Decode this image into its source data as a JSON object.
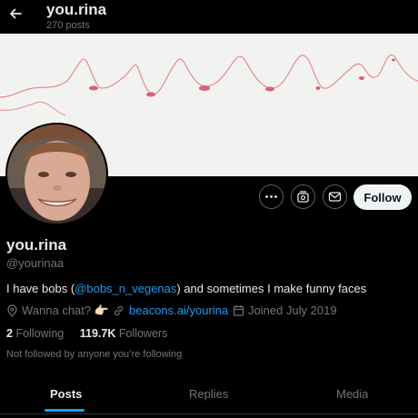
{
  "header": {
    "title": "you.rina",
    "post_count": "270 posts",
    "back_icon": "arrow-left-icon"
  },
  "profile": {
    "display_name": "you.rina",
    "handle": "@yourinaa",
    "bio": {
      "prefix": "I have bobs (",
      "mention": "@bobs_n_vegenas",
      "suffix": ") and sometimes I make funny faces"
    },
    "location": "Wanna chat? 👉🏻",
    "website": "beacons.ai/yourina",
    "joined": "Joined July 2019",
    "following_count": "2",
    "following_label": "Following",
    "followers_count": "119.7K",
    "followers_label": "Followers",
    "followed_by_note": "Not followed by anyone you’re following"
  },
  "actions": {
    "more_icon": "more-icon",
    "subscribe_icon": "subscribe-icon",
    "message_icon": "envelope-icon",
    "follow_label": "Follow"
  },
  "tabs": [
    {
      "label": "Posts",
      "active": true
    },
    {
      "label": "Replies",
      "active": false
    },
    {
      "label": "Media",
      "active": false
    }
  ],
  "colors": {
    "background": "#000000",
    "accent": "#1d9bf0",
    "text_primary": "#e7e9ea",
    "text_secondary": "#71767b",
    "follow_button": "#eff3f4",
    "banner_bg": "#f2f2f1",
    "banner_line": "#e48a9a"
  }
}
